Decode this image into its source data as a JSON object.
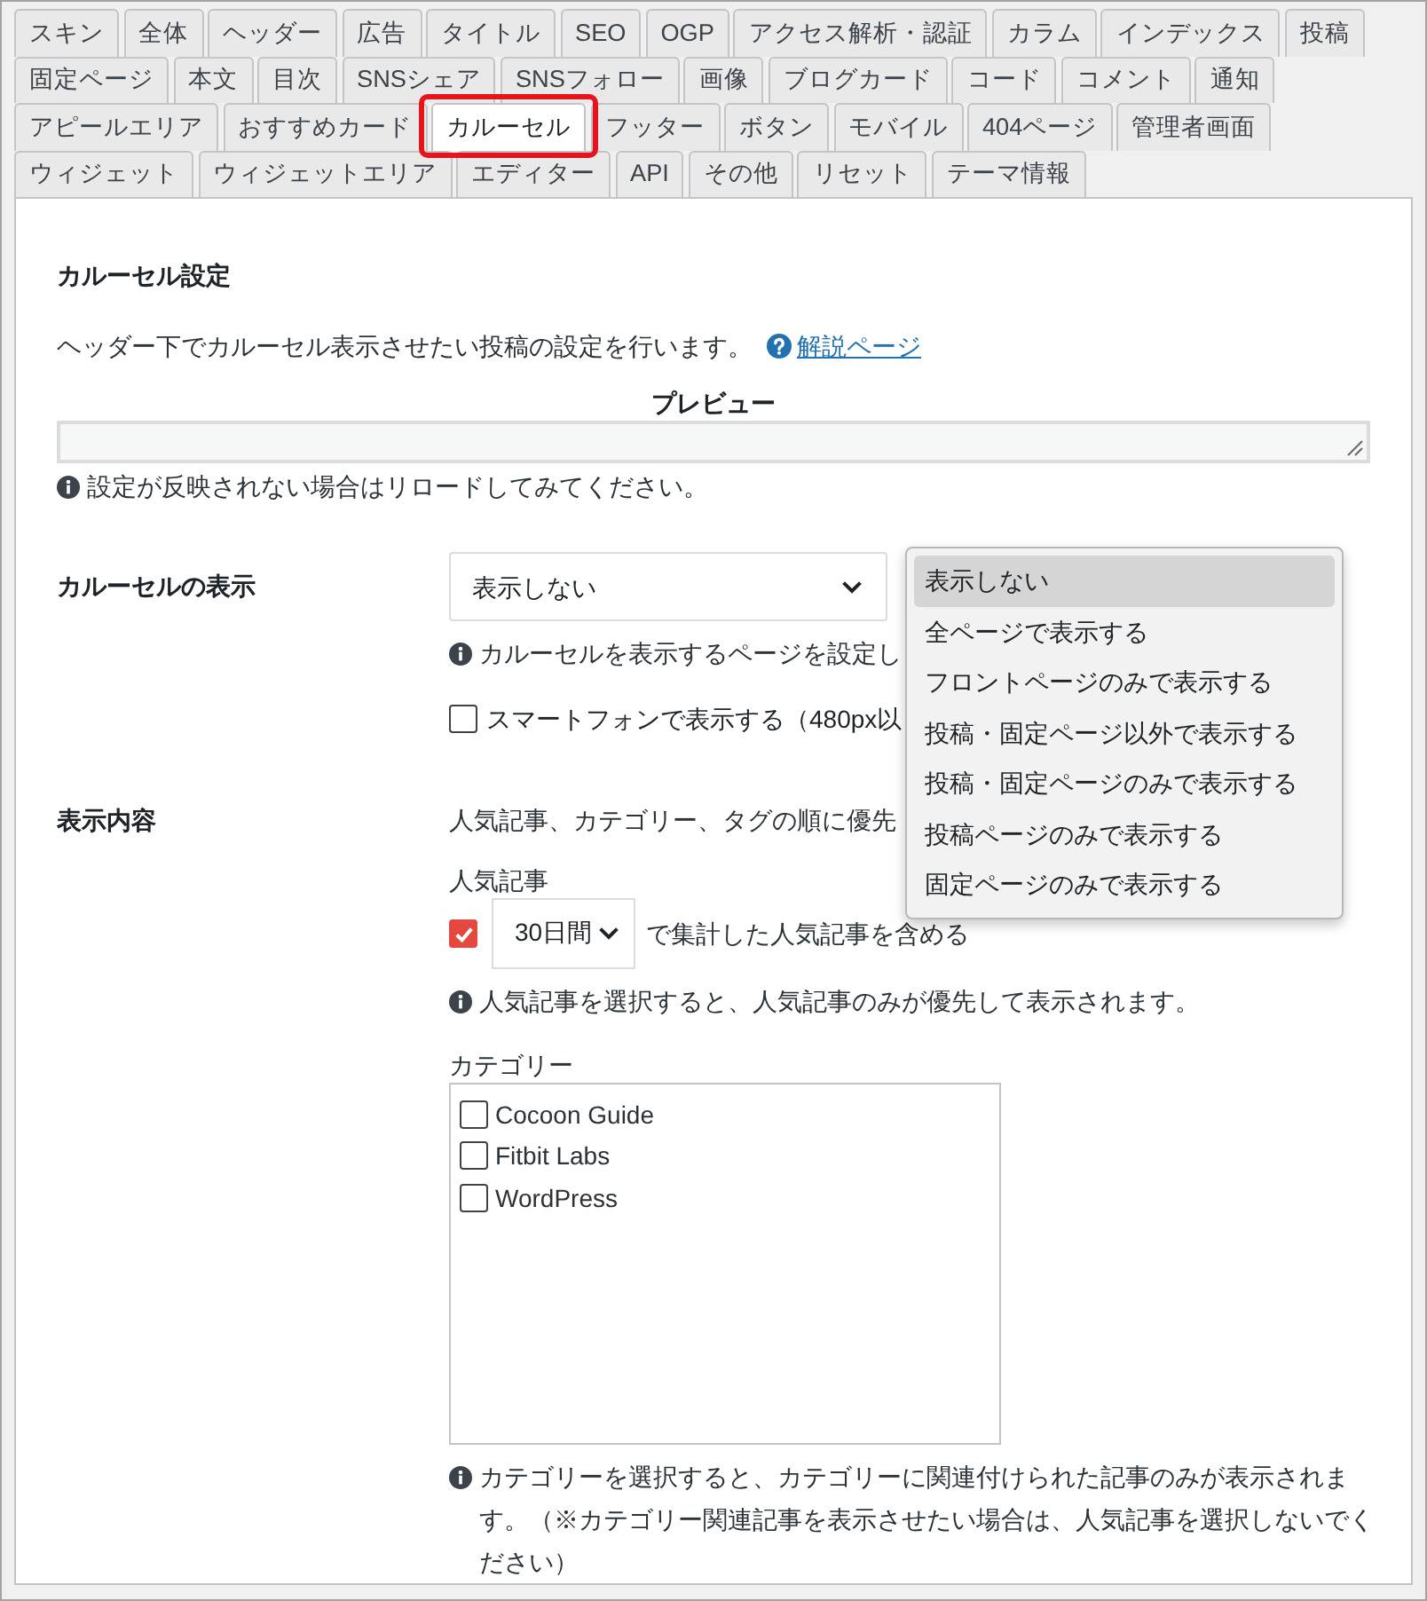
{
  "tab_rows": [
    {
      "tabs": [
        {
          "label": "スキン",
          "selected": false,
          "highlighted": false
        },
        {
          "label": "全体",
          "selected": false,
          "highlighted": false
        },
        {
          "label": "ヘッダー",
          "selected": false,
          "highlighted": false
        },
        {
          "label": "広告",
          "selected": false,
          "highlighted": false
        },
        {
          "label": "タイトル",
          "selected": false,
          "highlighted": false
        },
        {
          "label": "SEO",
          "selected": false,
          "highlighted": false
        },
        {
          "label": "OGP",
          "selected": false,
          "highlighted": false
        },
        {
          "label": "アクセス解析・認証",
          "selected": false,
          "highlighted": false
        },
        {
          "label": "カラム",
          "selected": false,
          "highlighted": false
        },
        {
          "label": "インデックス",
          "selected": false,
          "highlighted": false
        },
        {
          "label": "投稿",
          "selected": false,
          "highlighted": false
        }
      ]
    },
    {
      "tabs": [
        {
          "label": "固定ページ",
          "selected": false,
          "highlighted": false
        },
        {
          "label": "本文",
          "selected": false,
          "highlighted": false
        },
        {
          "label": "目次",
          "selected": false,
          "highlighted": false
        },
        {
          "label": "SNSシェア",
          "selected": false,
          "highlighted": false
        },
        {
          "label": "SNSフォロー",
          "selected": false,
          "highlighted": false
        },
        {
          "label": "画像",
          "selected": false,
          "highlighted": false
        },
        {
          "label": "ブログカード",
          "selected": false,
          "highlighted": false
        },
        {
          "label": "コード",
          "selected": false,
          "highlighted": false
        },
        {
          "label": "コメント",
          "selected": false,
          "highlighted": false
        },
        {
          "label": "通知",
          "selected": false,
          "highlighted": false
        }
      ]
    },
    {
      "tabs": [
        {
          "label": "アピールエリア",
          "selected": false,
          "highlighted": false
        },
        {
          "label": "おすすめカード",
          "selected": false,
          "highlighted": false
        },
        {
          "label": "カルーセル",
          "selected": true,
          "highlighted": true
        },
        {
          "label": "フッター",
          "selected": false,
          "highlighted": false
        },
        {
          "label": "ボタン",
          "selected": false,
          "highlighted": false
        },
        {
          "label": "モバイル",
          "selected": false,
          "highlighted": false
        },
        {
          "label": "404ページ",
          "selected": false,
          "highlighted": false
        },
        {
          "label": "管理者画面",
          "selected": false,
          "highlighted": false
        }
      ]
    },
    {
      "tabs": [
        {
          "label": "ウィジェット",
          "selected": false,
          "highlighted": false
        },
        {
          "label": "ウィジェットエリア",
          "selected": false,
          "highlighted": false
        },
        {
          "label": "エディター",
          "selected": false,
          "highlighted": false
        },
        {
          "label": "API",
          "selected": false,
          "highlighted": false
        },
        {
          "label": "その他",
          "selected": false,
          "highlighted": false
        },
        {
          "label": "リセット",
          "selected": false,
          "highlighted": false
        },
        {
          "label": "テーマ情報",
          "selected": false,
          "highlighted": false
        }
      ]
    }
  ],
  "section": {
    "title": "カルーセル設定",
    "description": "ヘッダー下でカルーセル表示させたい投稿の設定を行います。",
    "help_link": "解説ページ",
    "preview_label": "プレビュー",
    "note": "設定が反映されない場合はリロードしてみてください。"
  },
  "settings": [
    {
      "label": "カルーセルの表示",
      "items": [
        {
          "kind": "select",
          "value": "表示しない",
          "expanded": true,
          "options": [
            {
              "label": "表示しない",
              "selected": true
            },
            {
              "label": "全ページで表示する",
              "selected": false
            },
            {
              "label": "フロントページのみで表示する",
              "selected": false
            },
            {
              "label": "投稿・固定ページ以外で表示する",
              "selected": false
            },
            {
              "label": "投稿・固定ページのみで表示する",
              "selected": false
            },
            {
              "label": "投稿ページのみで表示する",
              "selected": false
            },
            {
              "label": "固定ページのみで表示する",
              "selected": false
            }
          ]
        },
        {
          "kind": "note",
          "text": "カルーセルを表示するページを設定し"
        },
        {
          "kind": "checkbox",
          "label": "スマートフォンで表示する（480px以",
          "checked": false
        }
      ]
    },
    {
      "label": "表示内容",
      "items": [
        {
          "kind": "text",
          "text": "人気記事、カテゴリー、タグの順に優先"
        },
        {
          "kind": "caption",
          "text": "人気記事"
        },
        {
          "kind": "checkbox_select",
          "checked": true,
          "value": "30日間",
          "suffix": "で集計した人気記事を含める"
        },
        {
          "kind": "note",
          "text": "人気記事を選択すると、人気記事のみが優先して表示されます。"
        },
        {
          "kind": "caption",
          "text": "カテゴリー"
        },
        {
          "kind": "checklist",
          "items": [
            {
              "label": "Cocoon Guide",
              "checked": false
            },
            {
              "label": "Fitbit Labs",
              "checked": false
            },
            {
              "label": "WordPress",
              "checked": false
            }
          ]
        },
        {
          "kind": "note",
          "text": "カテゴリーを選択すると、カテゴリーに関連付けられた記事のみが表示されます。（※カテゴリー関連記事を表示させたい場合は、人気記事を選択しないでください）"
        }
      ]
    }
  ]
}
